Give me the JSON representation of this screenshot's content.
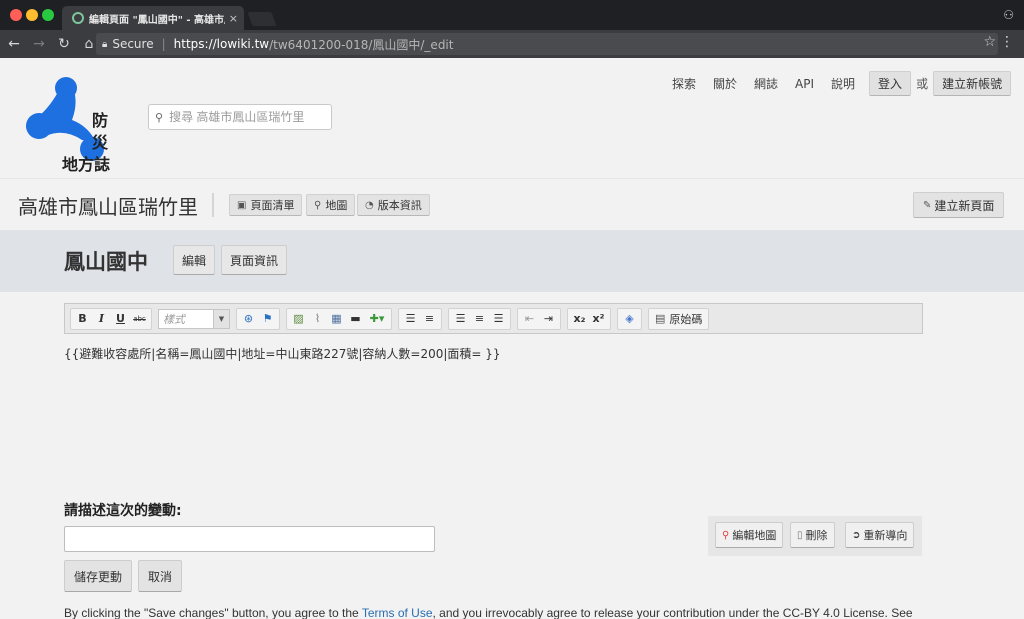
{
  "browser": {
    "tab_title": "編輯頁面 \"鳳山國中\" - 高雄市鳳",
    "tab_close": "×",
    "secure_label": "Secure",
    "url_host": "https://lowiki.tw",
    "url_path": "/tw6401200-018/鳳山國中/_edit",
    "back_icon": "back-arrow-icon",
    "forward_icon": "forward-arrow-icon",
    "reload_icon": "reload-icon",
    "home_icon": "home-icon"
  },
  "site": {
    "logo_line1": "防災",
    "logo_line2": "地方誌",
    "search_placeholder": "搜尋 高雄市鳳山區瑞竹里",
    "nav": [
      "探索",
      "關於",
      "網誌",
      "API",
      "說明"
    ],
    "login": "登入",
    "or": "或",
    "signup": "建立新帳號",
    "brand_color": "#1e6fe0"
  },
  "region": {
    "title": "高雄市鳳山區瑞竹里",
    "buttons": {
      "page_list": "頁面清單",
      "map": "地圖",
      "changes": "版本資訊"
    },
    "new_page": "建立新頁面"
  },
  "page": {
    "title": "鳳山國中",
    "edit": "編輯",
    "info": "頁面資訊"
  },
  "editor": {
    "bold": "B",
    "italic": "I",
    "underline": "U",
    "strike": "abc",
    "style_placeholder": "樣式",
    "subscript": "x₂",
    "superscript": "x²",
    "source": "原始碼",
    "content": "{{避難收容處所|名稱=鳳山國中|地址=中山東路227號|容納人數=200|面積= }}"
  },
  "form": {
    "describe_label": "請描述這次的變動:",
    "save": "儲存更動",
    "cancel": "取消",
    "edit_map": "編輯地圖",
    "delete": "刪除",
    "redirect": "重新導向"
  },
  "license": {
    "before": "By clicking the \"Save changes\" button, you agree to the ",
    "link": "Terms of Use",
    "after": ", and you irrevocably agree to release your contribution under the CC-BY 4.0 License. See"
  }
}
